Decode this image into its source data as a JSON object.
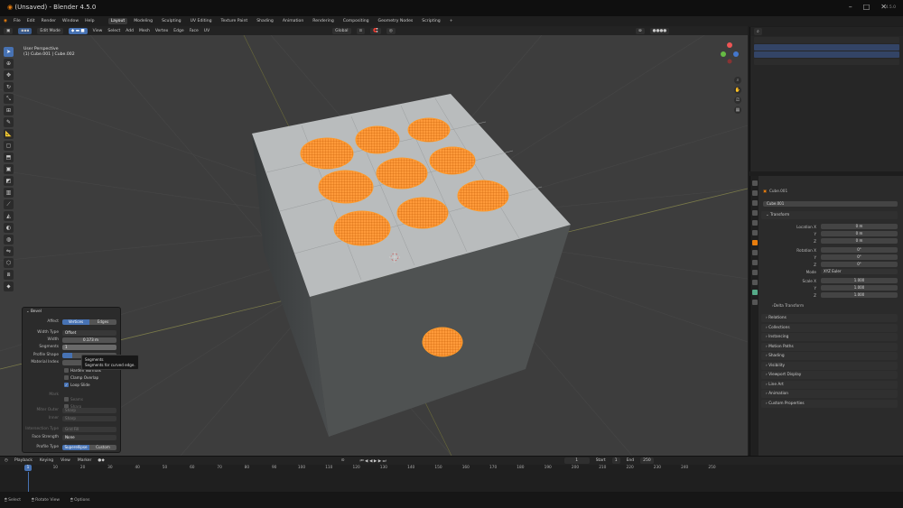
{
  "app": {
    "title": "(Unsaved) - Blender 4.5.0"
  },
  "menu": {
    "items": [
      "File",
      "Edit",
      "Render",
      "Window",
      "Help"
    ],
    "workspaces": [
      "Layout",
      "Modeling",
      "Sculpting",
      "UV Editing",
      "Texture Paint",
      "Shading",
      "Animation",
      "Rendering",
      "Compositing",
      "Geometry Nodes",
      "Scripting"
    ],
    "active_workspace": "Layout"
  },
  "viewport_header": {
    "mode": "Edit Mode",
    "menus": [
      "View",
      "Select",
      "Add",
      "Mesh",
      "Vertex",
      "Edge",
      "Face",
      "UV"
    ],
    "orientation": "Global"
  },
  "viewport": {
    "perspective": "User Perspective",
    "object_info": "(1) Cube.001 | Cube.002"
  },
  "bevel_panel": {
    "title": "Bevel",
    "affect_label": "Affect",
    "affect_options": [
      "Vertices",
      "Edges"
    ],
    "affect_selected": "Vertices",
    "width_type_label": "Width Type",
    "width_type": "Offset",
    "width_label": "Width",
    "width": "0.173 m",
    "segments_label": "Segments",
    "segments": "1",
    "profile_shape_label": "Profile Shape",
    "material_index_label": "Material Index",
    "checks": [
      {
        "label": "Harden Normals",
        "checked": false,
        "dim": false
      },
      {
        "label": "Clamp Overlap",
        "checked": false,
        "dim": false
      },
      {
        "label": "Loop Slide",
        "checked": true,
        "dim": false
      },
      {
        "label": "Seams",
        "checked": false,
        "dim": true
      },
      {
        "label": "Sharp",
        "checked": false,
        "dim": true
      }
    ],
    "mark_label": "Mark",
    "miter_outer_label": "Miter Outer",
    "miter_outer": "Sharp",
    "inner_label": "Inner",
    "inner": "Sharp",
    "intersection_label": "Intersection Type",
    "intersection": "Grid Fill",
    "face_strength_label": "Face Strength",
    "face_strength": "None",
    "profile_type_label": "Profile Type",
    "profile_options": [
      "Superellipse",
      "Custom"
    ],
    "profile_selected": "Superellipse"
  },
  "tooltip": {
    "title": "Segments",
    "description": "Segments for curved edge."
  },
  "outliner": {
    "rows": 4
  },
  "properties": {
    "object_name": "Cube.001",
    "data_name": "Cube.001",
    "transform_label": "Transform",
    "location_label": "Location X",
    "rotation_label": "Rotation X",
    "mode_label": "Mode",
    "mode_value": "XYZ Euler",
    "scale_label": "Scale X",
    "axis_y": "Y",
    "axis_z": "Z",
    "location": [
      "0 m",
      "0 m",
      "0 m"
    ],
    "rotation": [
      "0°",
      "0°",
      "0°"
    ],
    "scale": [
      "1.000",
      "1.000",
      "1.000"
    ],
    "delta_transform": "Delta Transform",
    "sections": [
      "Relations",
      "Collections",
      "Instancing",
      "Motion Paths",
      "Shading",
      "Visibility",
      "Viewport Display",
      "Line Art",
      "Animation",
      "Custom Properties"
    ]
  },
  "timeline": {
    "menus": [
      "Playback",
      "Keying",
      "View",
      "Marker"
    ],
    "current_frame": "1",
    "frame_field": "1",
    "start_label": "Start",
    "start": "1",
    "end_label": "End",
    "end": "250",
    "ticks": [
      "1",
      "10",
      "20",
      "30",
      "40",
      "50",
      "60",
      "70",
      "80",
      "90",
      "100",
      "110",
      "120",
      "130",
      "140",
      "150",
      "160",
      "170",
      "180",
      "190",
      "200",
      "210",
      "220",
      "230",
      "240",
      "250"
    ]
  },
  "status": {
    "items": [
      "Select",
      "Rotate View",
      "Options"
    ],
    "version": "4.5.0"
  },
  "colors": {
    "accent": "#4772b3",
    "selection": "#ff8c1a",
    "viewport_bg": "#3d3d3d"
  },
  "icons": [
    "blender-logo-icon",
    "cursor-icon",
    "move-icon",
    "rotate-icon",
    "scale-icon",
    "extrude-icon",
    "bevel-icon",
    "knife-icon",
    "zoom-icon",
    "hand-icon",
    "camera-icon"
  ]
}
